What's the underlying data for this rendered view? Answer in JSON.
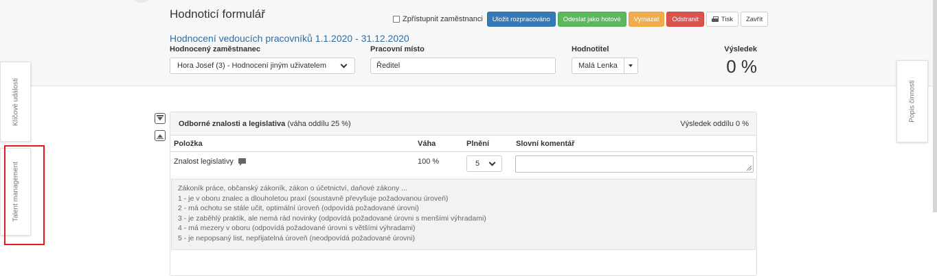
{
  "header": {
    "title": "Hodnoticí formulář",
    "subtitle": "Hodnocení vedoucích pracovníků 1.1.2020 - 31.12.2020"
  },
  "toolbar": {
    "share_checkbox_label": "Zpřístupnit zaměstnanci",
    "share_checked": false,
    "save_draft": "Uložit rozpracováno",
    "send_done": "Odeslat jako hotové",
    "clear": "Vymazat",
    "remove": "Odstranit",
    "print": "Tisk",
    "close": "Zavřít"
  },
  "fields": {
    "employee_label": "Hodnocený zaměstnanec",
    "employee_value": "Hora Josef (3) - Hodnocení jiným uživatelem",
    "position_label": "Pracovní místo",
    "position_value": "Ředitel",
    "rater_label": "Hodnotitel",
    "rater_value": "Malá Lenka",
    "result_label": "Výsledek",
    "result_value": "0 %"
  },
  "side_tabs": {
    "left_top": "Klíčové události",
    "left_bottom": "Talent management",
    "right": "Popis činnosti"
  },
  "section": {
    "title": "Odborné znalosti a legislativa",
    "weight_note": "(váha oddílu 25 %)",
    "result": "Výsledek oddílu 0 %",
    "columns": [
      "Položka",
      "Váha",
      "Plnění",
      "Slovní komentář"
    ],
    "item": {
      "name": "Znalost legislativy",
      "weight": "100 %",
      "score": "5",
      "comment": ""
    },
    "description": [
      "Zákoník práce, občanský zákoník, zákon o účetnictví, daňové zákony ...",
      "1 - je v oboru znalec a dlouholetou praxí (soustavně převyšuje požadovanou úroveň)",
      "2 - má ochotu se stále učit, optimální úroveň (odpovídá požadované úrovni)",
      "3 - je zaběhlý praktik, ale nemá rád novinky (odpovídá požadované úrovni s menšími výhradami)",
      "4 - má mezery v oboru (odpovídá požadované úrovni s většími výhradami)",
      "5 - je nepopsaný list, nepřijatelná úroveň (neodpovídá požadované úrovni)"
    ]
  },
  "colors": {
    "primary": "#337ab7",
    "success": "#5cb85c",
    "warning": "#f0ad4e",
    "danger": "#d9534f",
    "highlight": "#e0181f"
  }
}
